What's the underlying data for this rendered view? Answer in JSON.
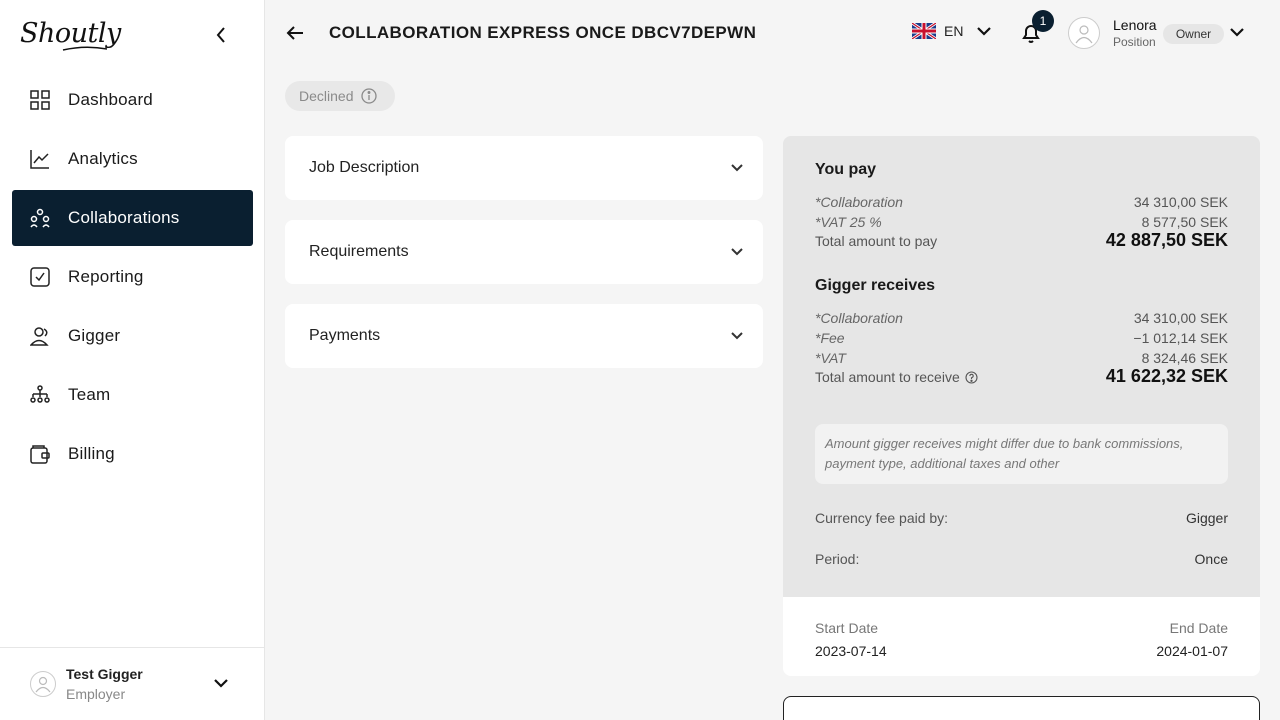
{
  "sidebar": {
    "logo": "Shoutly",
    "items": [
      {
        "label": "Dashboard",
        "icon": "grid-icon"
      },
      {
        "label": "Analytics",
        "icon": "chart-line-icon"
      },
      {
        "label": "Collaborations",
        "icon": "collaborations-icon",
        "active": true
      },
      {
        "label": "Reporting",
        "icon": "checkbox-icon"
      },
      {
        "label": "Gigger",
        "icon": "user-group-icon"
      },
      {
        "label": "Team",
        "icon": "team-tree-icon"
      },
      {
        "label": "Billing",
        "icon": "wallet-icon"
      }
    ],
    "user": {
      "name": "Test Gigger",
      "role": "Employer"
    }
  },
  "header": {
    "title": "COLLABORATION EXPRESS ONCE DBCV7DEPWN",
    "language": "EN",
    "notifications": "1",
    "user": {
      "name": "Lenora",
      "position": "Position",
      "badge": "Owner"
    }
  },
  "status": "Declined",
  "sections": [
    "Job Description",
    "Requirements",
    "Payments"
  ],
  "summary": {
    "you_pay": {
      "title": "You pay",
      "rows": [
        {
          "label": "*Collaboration",
          "value": "34 310,00 SEK"
        },
        {
          "label": "*VAT 25 %",
          "value": "8 577,50 SEK"
        }
      ],
      "total_label": "Total amount to pay",
      "total_value": "42 887,50 SEK"
    },
    "gigger_receives": {
      "title": "Gigger receives",
      "rows": [
        {
          "label": "*Collaboration",
          "value": "34 310,00 SEK"
        },
        {
          "label": "*Fee",
          "value": "−1 012,14 SEK"
        },
        {
          "label": "*VAT",
          "value": "8 324,46 SEK"
        }
      ],
      "total_label": "Total amount to receive",
      "total_value": "41 622,32 SEK"
    },
    "note": "Amount gigger receives might differ due to bank commissions, payment type, additional taxes and other",
    "currency_fee_label": "Currency fee paid by:",
    "currency_fee_value": "Gigger",
    "period_label": "Period:",
    "period_value": "Once"
  },
  "dates": {
    "start_label": "Start Date",
    "start_value": "2023-07-14",
    "end_label": "End Date",
    "end_value": "2024-01-07"
  },
  "colors": {
    "accent": "#0a1f30",
    "panel": "#e6e6e6",
    "background": "#f5f5f5"
  }
}
